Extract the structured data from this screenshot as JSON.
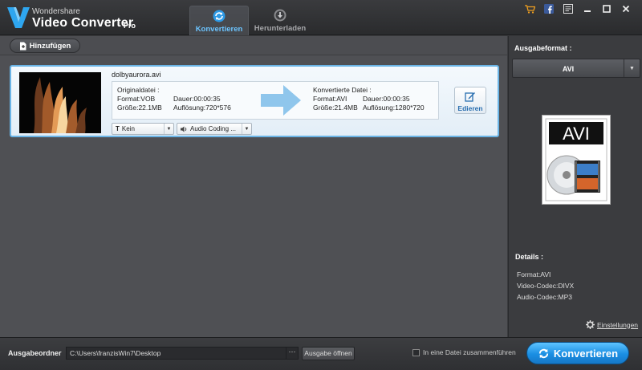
{
  "app": {
    "brand_small": "Wondershare",
    "brand_big": "Video Converter",
    "brand_pro": "Pro"
  },
  "tabs": [
    {
      "label": "Konvertieren",
      "icon": "refresh-icon",
      "active": true
    },
    {
      "label": "Herunterladen",
      "icon": "download-icon",
      "active": false
    }
  ],
  "window_controls": [
    "cart-icon",
    "facebook-icon",
    "register-icon",
    "minimize-icon",
    "maximize-icon",
    "close-icon"
  ],
  "toolbar": {
    "add_label": "Hinzufügen"
  },
  "file": {
    "name": "dolbyaurora.avi",
    "source": {
      "heading": "Originaldatei :",
      "format": "Format:VOB",
      "duration": "Dauer:00:00:35",
      "size": "Größe:22.1MB",
      "resolution": "Auflösung:720*576"
    },
    "target": {
      "heading": "Konvertierte Datei :",
      "format": "Format:AVI",
      "duration": "Dauer:00:00:35",
      "size": "Größe:21.4MB",
      "resolution": "Auflösung:1280*720"
    },
    "subtitle_select": "Kein",
    "audio_select": "Audio Coding ...",
    "edit_label": "Edieren"
  },
  "output_format": {
    "title": "Ausgabeformat :",
    "selected": "AVI",
    "icon_label": "AVI"
  },
  "details": {
    "title": "Details :",
    "format": "Format:AVI",
    "video_codec": "Video-Codec:DIVX",
    "audio_codec": "Audio-Codec:MP3",
    "settings_label": "Einstellungen"
  },
  "bottom": {
    "output_label": "Ausgabeordner",
    "output_path": "C:\\Users\\franzisWin7\\Desktop",
    "more_label": "···",
    "open_label": "Ausgabe öffnen",
    "merge_label": "In eine Datei zusammenführen",
    "convert_label": "Konvertieren"
  },
  "colors": {
    "accent": "#6cc4ff",
    "convert_button": "#1a8ee3",
    "card_border": "#6ab4e6",
    "arrow": "#8fc6ec"
  }
}
